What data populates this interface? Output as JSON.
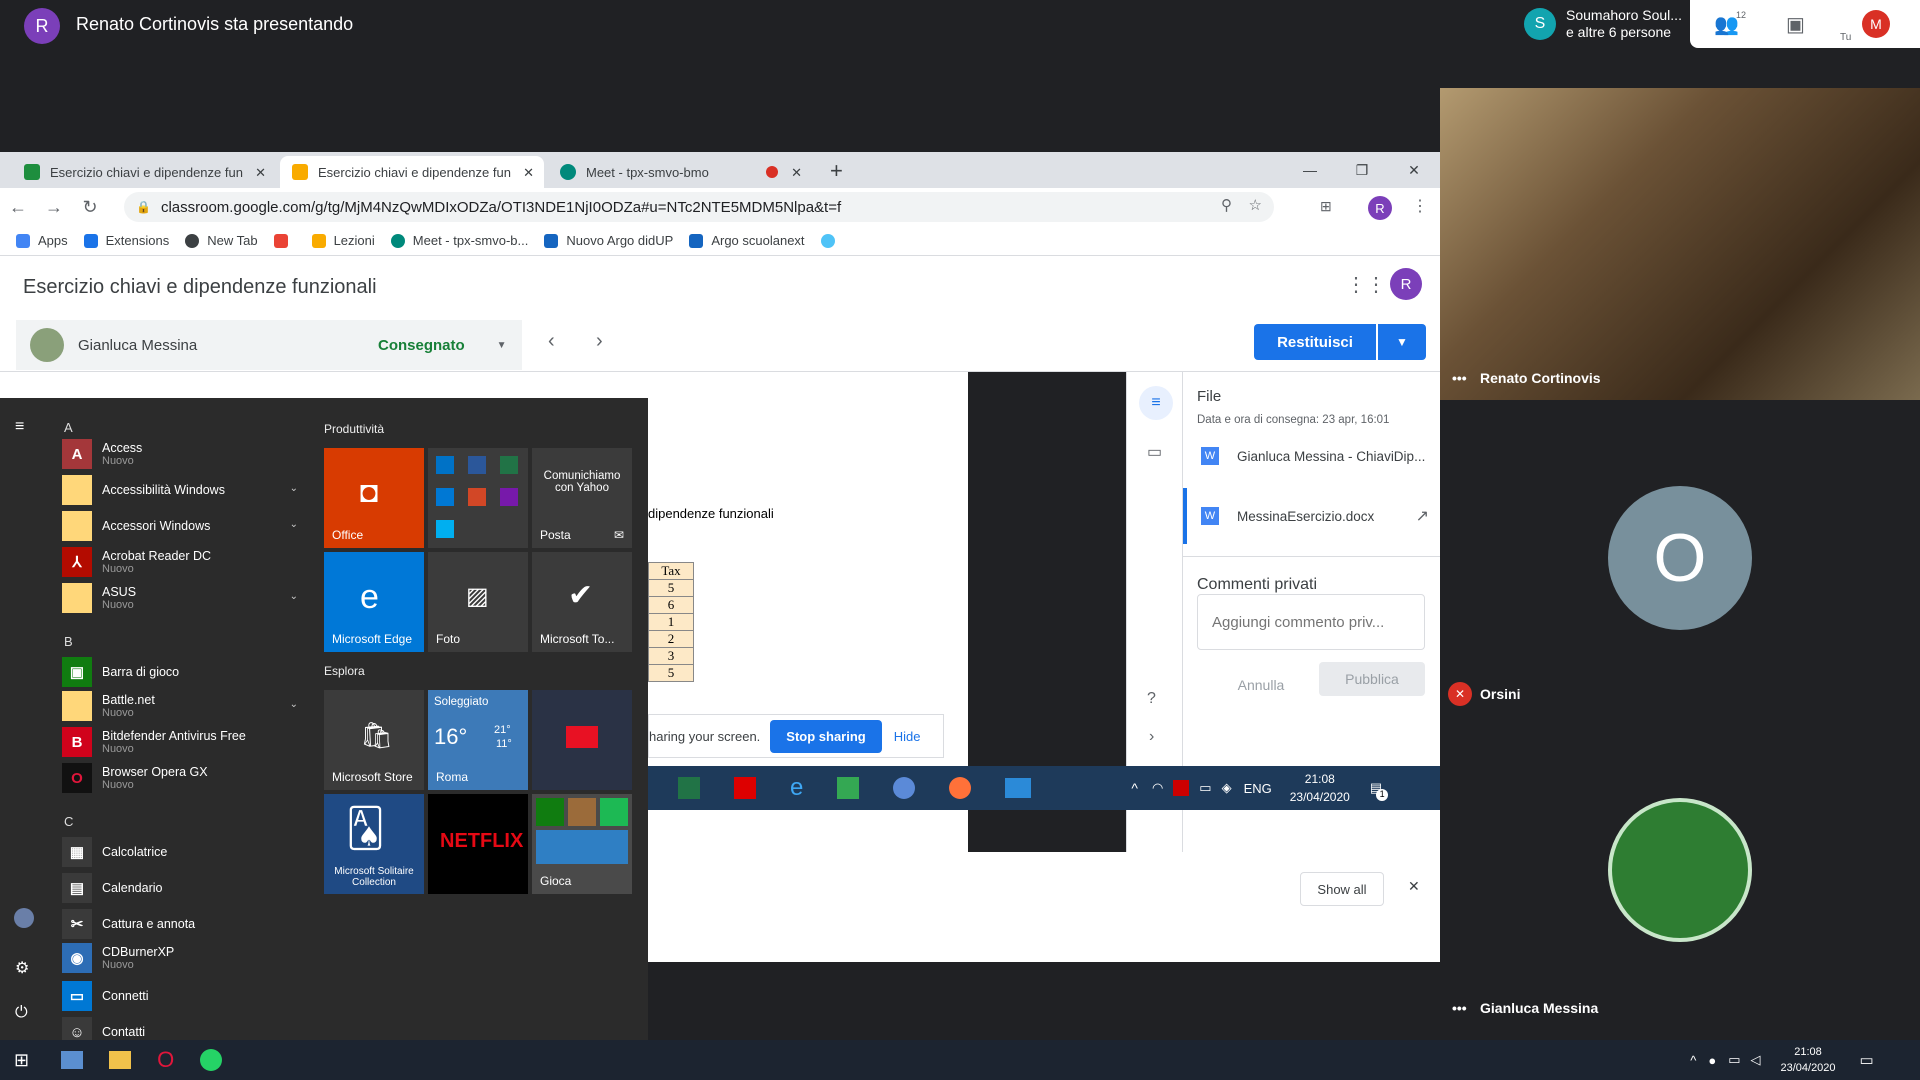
{
  "meet": {
    "presenter_initial": "R",
    "presenter_title": "Renato Cortinovis sta presentando",
    "chip_initial": "S",
    "chip_line1": "Soumahoro Soul...",
    "chip_line2": "e altre 6 persone",
    "people_count": "12",
    "me_initial": "M",
    "me_label": "Tu",
    "tiles": {
      "renato": "Renato Cortinovis",
      "orsini_initial": "O",
      "orsini": "Orsini",
      "gianluca": "Gianluca Messina"
    }
  },
  "browser": {
    "tabs": [
      {
        "label": "Esercizio chiavi e dipendenze fun"
      },
      {
        "label": "Esercizio chiavi e dipendenze fun"
      },
      {
        "label": "Meet - tpx-smvo-bmo"
      }
    ],
    "url": "classroom.google.com/g/tg/MjM4NzQwMDIxODZa/OTI3NDE1NjI0ODZa#u=NTc2NTE5MDM5Nlpa&t=f",
    "profile_initial": "R",
    "bookmarks": [
      "Apps",
      "Extensions",
      "New Tab",
      "Lezioni",
      "Meet - tpx-smvo-b...",
      "Nuovo Argo didUP",
      "Argo scuolanext"
    ]
  },
  "classroom": {
    "title": "Esercizio chiavi e dipendenze funzionali",
    "profile_initial": "R",
    "student_name": "Gianluca Messina",
    "student_status": "Consegnato",
    "return_button": "Restituisci",
    "doc_heading": "dipendenze funzionali",
    "table_header": "Tax",
    "table_values": [
      "5",
      "6",
      "1",
      "2",
      "3",
      "5"
    ],
    "panel": {
      "files_title": "File",
      "submitted": "Data e ora di consegna: 23 apr, 16:01",
      "file1": "Gianluca Messina - ChiaviDip...",
      "file2": "MessinaEsercizio.docx",
      "comments_title": "Commenti privati",
      "comment_placeholder": "Aggiungi commento priv...",
      "cancel": "Annulla",
      "publish": "Pubblica"
    }
  },
  "start_menu": {
    "letters": [
      "A",
      "B",
      "C"
    ],
    "apps": [
      {
        "name": "Access",
        "sub": "Nuovo"
      },
      {
        "name": "Accessibilità Windows",
        "sub": ""
      },
      {
        "name": "Accessori Windows",
        "sub": ""
      },
      {
        "name": "Acrobat Reader DC",
        "sub": "Nuovo"
      },
      {
        "name": "ASUS",
        "sub": "Nuovo"
      },
      {
        "name": "Barra di gioco",
        "sub": ""
      },
      {
        "name": "Battle.net",
        "sub": "Nuovo"
      },
      {
        "name": "Bitdefender Antivirus Free",
        "sub": "Nuovo"
      },
      {
        "name": "Browser Opera GX",
        "sub": "Nuovo"
      },
      {
        "name": "Calcolatrice",
        "sub": ""
      },
      {
        "name": "Calendario",
        "sub": ""
      },
      {
        "name": "Cattura e annota",
        "sub": ""
      },
      {
        "name": "CDBurnerXP",
        "sub": "Nuovo"
      },
      {
        "name": "Connetti",
        "sub": ""
      },
      {
        "name": "Contatti",
        "sub": ""
      }
    ],
    "section1": "Produttività",
    "section2": "Esplora",
    "tiles": {
      "office": "Office",
      "yahoo": "Comunichiamo con Yahoo",
      "posta": "Posta",
      "edge": "Microsoft Edge",
      "foto": "Foto",
      "todo": "Microsoft To...",
      "store": "Microsoft Store",
      "weather_title": "Soleggiato",
      "weather_temp": "16°",
      "weather_high": "21°",
      "weather_low": "11°",
      "weather_city": "Roma",
      "solitaire": "Microsoft Solitaire Collection",
      "netflix": "NETFLIX",
      "gioca": "Gioca"
    }
  },
  "share_bar": {
    "text": "haring your screen.",
    "stop": "Stop sharing",
    "hide": "Hide",
    "show_all": "Show all"
  },
  "shared_taskbar": {
    "lang": "ENG",
    "time": "21:08",
    "date": "23/04/2020",
    "notif": "1"
  },
  "taskbar": {
    "time": "21:08",
    "date": "23/04/2020"
  }
}
